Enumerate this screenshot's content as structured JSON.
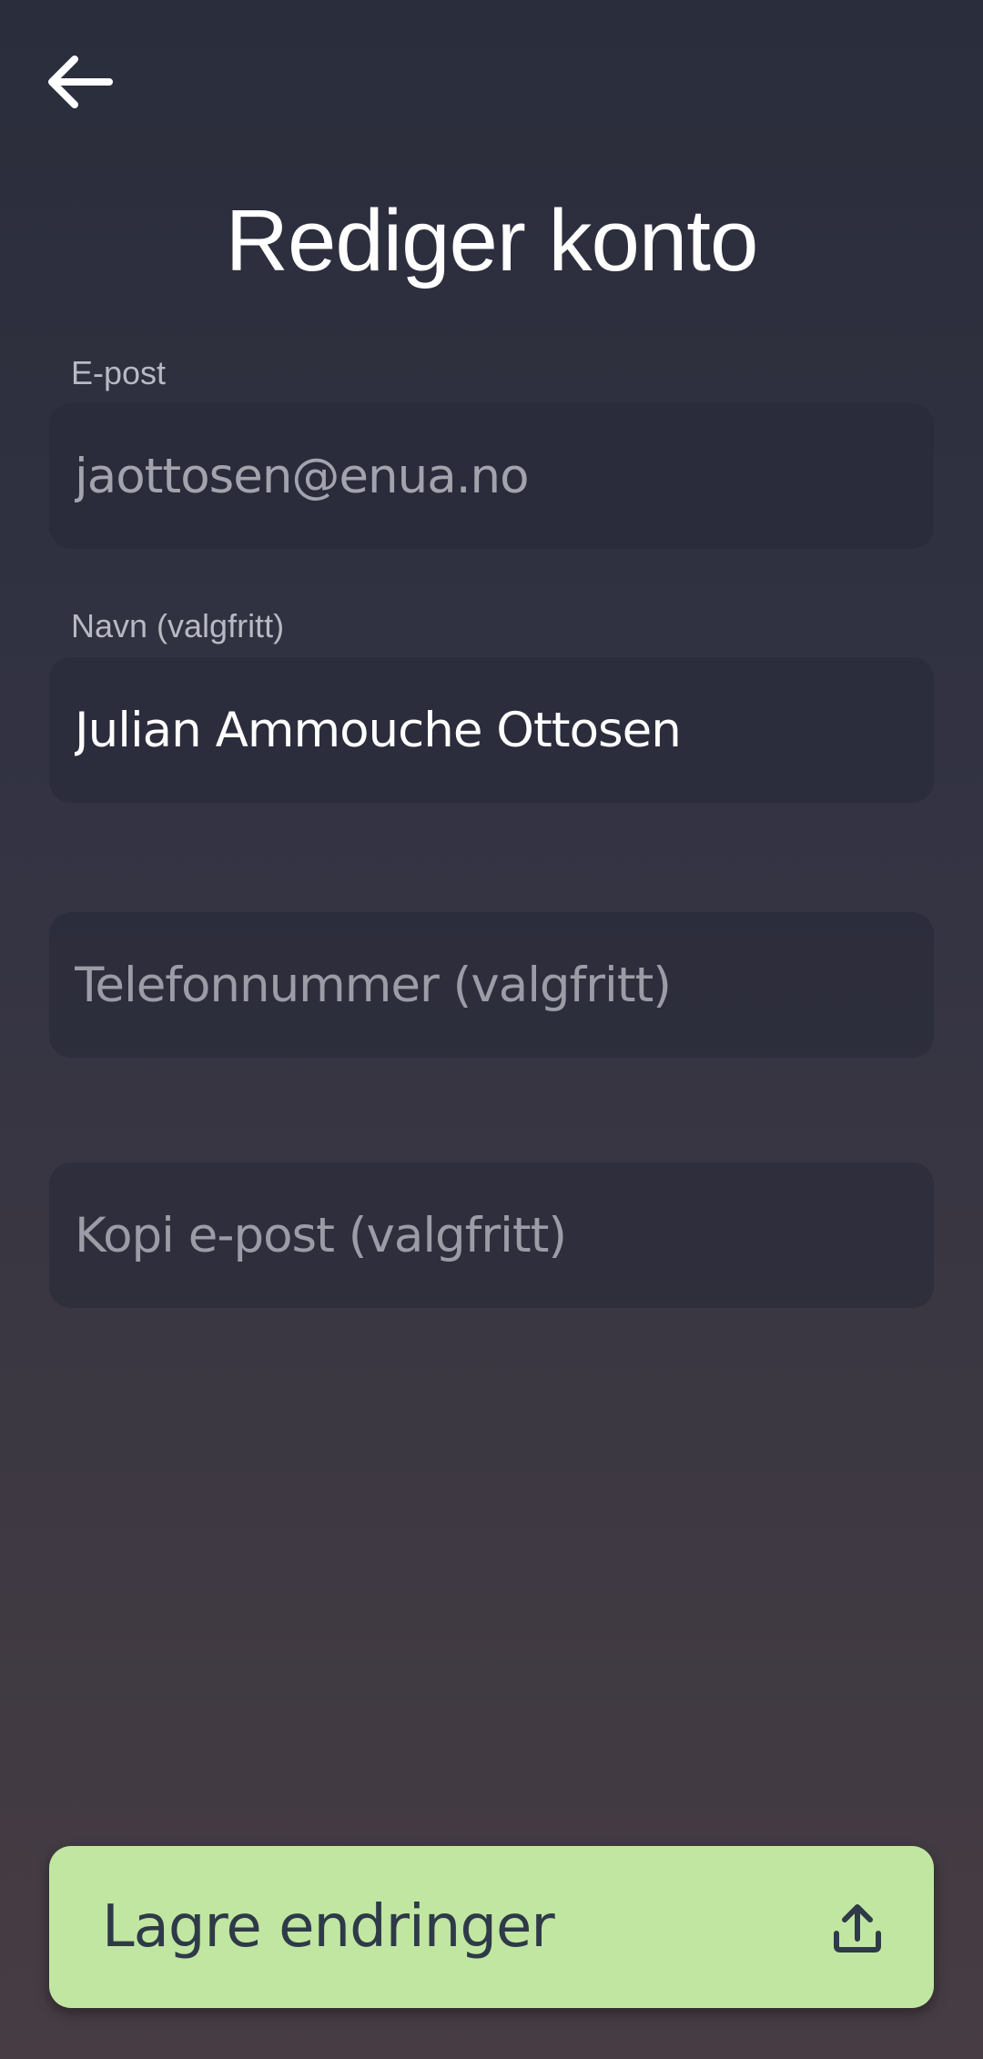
{
  "header": {
    "title": "Rediger konto",
    "back_icon": "arrow-left-icon"
  },
  "form": {
    "email": {
      "label": "E-post",
      "value": "jaottosen@enua.no",
      "placeholder": ""
    },
    "name": {
      "label": "Navn (valgfritt)",
      "value": "Julian Ammouche Ottosen",
      "placeholder": ""
    },
    "phone": {
      "value": "",
      "placeholder": "Telefonnummer (valgfritt)"
    },
    "copy_email": {
      "value": "",
      "placeholder": "Kopi e-post (valgfritt)"
    }
  },
  "actions": {
    "save_label": "Lagre endringer",
    "save_icon": "upload-icon"
  },
  "colors": {
    "background_top": "#2a2d3b",
    "background_bottom": "#473c43",
    "field_background": "#2c2e3b",
    "primary_button": "#c1e6a1",
    "button_text": "#2e3a48"
  }
}
